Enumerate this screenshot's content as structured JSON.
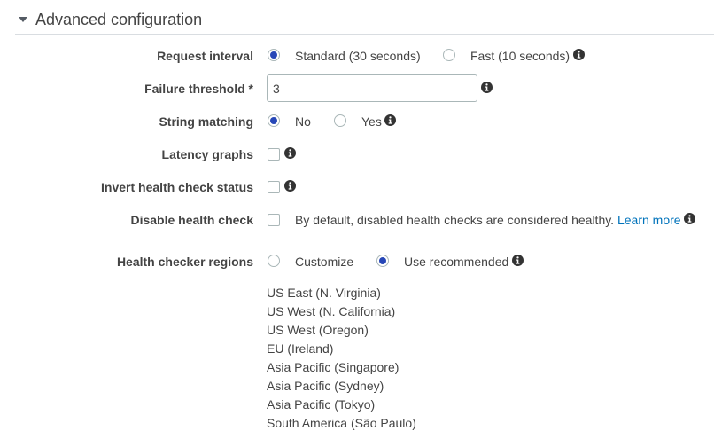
{
  "section": {
    "title": "Advanced configuration"
  },
  "request_interval": {
    "label": "Request interval",
    "options": [
      {
        "label": "Standard (30 seconds)",
        "selected": true
      },
      {
        "label": "Fast (10 seconds)",
        "selected": false
      }
    ]
  },
  "failure_threshold": {
    "label": "Failure threshold *",
    "value": "3"
  },
  "string_matching": {
    "label": "String matching",
    "options": [
      {
        "label": "No",
        "selected": true
      },
      {
        "label": "Yes",
        "selected": false
      }
    ]
  },
  "latency_graphs": {
    "label": "Latency graphs",
    "checked": false
  },
  "invert_health_check": {
    "label": "Invert health check status",
    "checked": false
  },
  "disable_health_check": {
    "label": "Disable health check",
    "checked": false,
    "description": "By default, disabled health checks are considered healthy.",
    "link_text": "Learn more"
  },
  "health_checker_regions": {
    "label": "Health checker regions",
    "options": [
      {
        "label": "Customize",
        "selected": false
      },
      {
        "label": "Use recommended",
        "selected": true
      }
    ],
    "regions": [
      "US East (N. Virginia)",
      "US West (N. California)",
      "US West (Oregon)",
      "EU (Ireland)",
      "Asia Pacific (Singapore)",
      "Asia Pacific (Sydney)",
      "Asia Pacific (Tokyo)",
      "South America (São Paulo)"
    ]
  },
  "colors": {
    "radio_selected": "#2747b7",
    "link": "#0073bb",
    "text": "#444444",
    "border": "#aab7b8"
  },
  "icons": {
    "info": "info-circle-icon",
    "caret": "caret-down-icon"
  }
}
